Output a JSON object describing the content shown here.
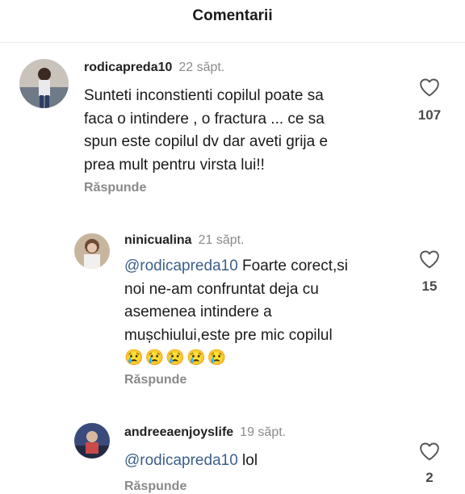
{
  "header": {
    "title": "Comentarii"
  },
  "comments": [
    {
      "username": "rodicapreda10",
      "time": "22 săpt.",
      "text": "Sunteti inconstienti copilul poate sa face o intindere , o fractura ... ce sa spun este copilul dv dar aveti grija e prea mult pentru virsta lui!!",
      "lines": [
        "Sunteti inconstienti copilul poate sa",
        "faca o intindere , o fractura ... ce sa",
        "spun este copilul dv dar aveti grija e",
        "prea mult pentru virsta lui!!"
      ],
      "reply_label": "Răspunde",
      "likes": "107"
    },
    {
      "username": "ninicualina",
      "time": "21 săpt.",
      "mention": "@rodicapreda10",
      "lines": [
        " Foarte corect,si",
        "noi ne-am confruntat deja cu",
        "asemenea intindere a",
        "mușchiului,este pre mic copilul"
      ],
      "emojis": [
        "😢",
        "😢",
        "😢",
        "😢",
        "😢"
      ],
      "reply_label": "Răspunde",
      "likes": "15"
    },
    {
      "username": "andreeaenjoyslife",
      "time": "19 săpt.",
      "mention": "@rodicapreda10",
      "lines": [
        " lol"
      ],
      "reply_label": "Răspunde",
      "likes": "2"
    }
  ],
  "colors": {
    "mention": "#3b5f8a",
    "muted": "#8a8a8a"
  },
  "icons": {
    "like": "heart-outline-icon"
  }
}
